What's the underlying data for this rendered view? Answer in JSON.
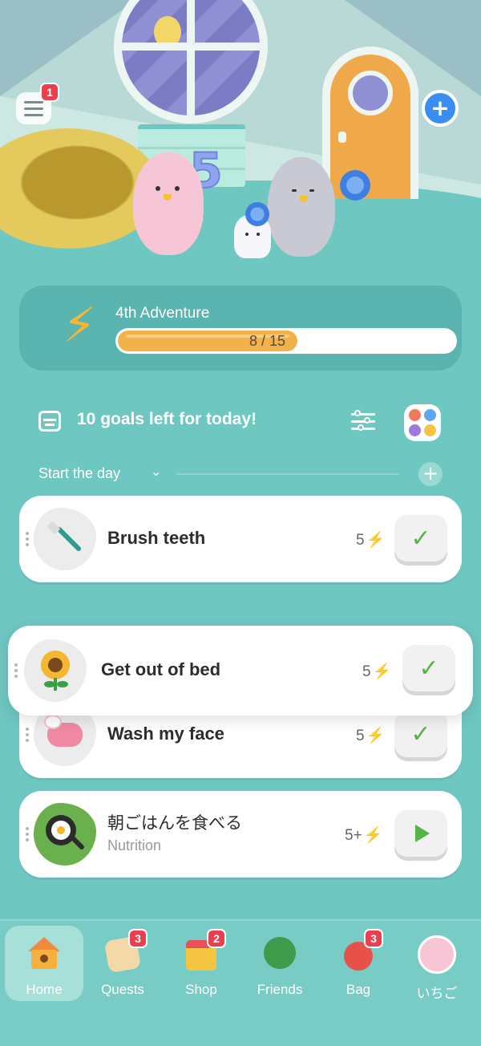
{
  "header": {
    "menu_badge": "1"
  },
  "scene": {
    "balloon_number": "5"
  },
  "adventure": {
    "title": "4th Adventure",
    "progress_label": "8 / 15",
    "progress_value": 8,
    "progress_max": 15,
    "accent": "#f2b24a"
  },
  "goals": {
    "headline": "10 goals left for today!"
  },
  "section": {
    "label": "Start the day",
    "chevron": "⌄",
    "add": "+"
  },
  "habits": [
    {
      "name": "Brush teeth",
      "points": "5",
      "icon": "toothbrush-icon",
      "state": "done",
      "check": "✓"
    },
    {
      "name": "Get out of bed",
      "points": "5",
      "icon": "sunflower-icon",
      "state": "done",
      "check": "✓"
    },
    {
      "name": "Wash my face",
      "points": "5",
      "icon": "soap-icon",
      "state": "done",
      "check": "✓"
    },
    {
      "name": "朝ごはんを食べる",
      "subtitle": "Nutrition",
      "points": "5+",
      "icon": "frying-pan-icon",
      "state": "play"
    }
  ],
  "tabs": [
    {
      "label": "Home",
      "icon": "home-icon",
      "active": true
    },
    {
      "label": "Quests",
      "icon": "quests-icon",
      "badge": "3"
    },
    {
      "label": "Shop",
      "icon": "shop-icon",
      "badge": "2"
    },
    {
      "label": "Friends",
      "icon": "tree-icon"
    },
    {
      "label": "Bag",
      "icon": "bag-icon",
      "badge": "3"
    },
    {
      "label": "いちご",
      "icon": "profile-avatar-icon"
    }
  ],
  "colors": {
    "background": "#6fc7c1",
    "bolt": "#f7b733",
    "check": "#56b348",
    "badge": "#e8404e"
  }
}
